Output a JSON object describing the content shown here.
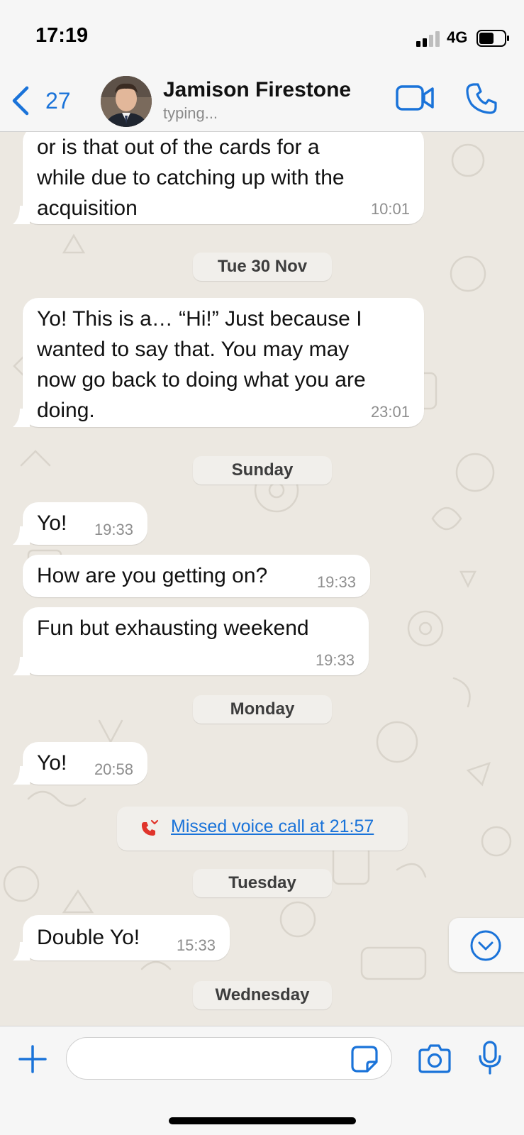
{
  "status_bar": {
    "time": "17:19",
    "network": "4G"
  },
  "header": {
    "back_count": "27",
    "contact_name": "Jamison Firestone",
    "contact_status": "typing..."
  },
  "messages": [
    {
      "text": [
        "or is that out of the cards for a",
        "while due to catching up with the",
        "acquisition"
      ],
      "time": "10:01"
    },
    {
      "text": [
        "Yo!  This is a… “Hi!” Just because I",
        "wanted to say that. You may may",
        "now go back to doing what you are",
        "doing."
      ],
      "time": "23:01"
    },
    {
      "text": [
        "Yo!"
      ],
      "time": "19:33"
    },
    {
      "text": [
        "How are you getting on?"
      ],
      "time": "19:33"
    },
    {
      "text": [
        "Fun but exhausting weekend"
      ],
      "time": "19:33"
    },
    {
      "text": [
        "Yo!"
      ],
      "time": "20:58"
    },
    {
      "text": [
        "Double Yo!"
      ],
      "time": "15:33"
    }
  ],
  "date_separators": [
    "Tue 30 Nov",
    "Sunday",
    "Monday",
    "Tuesday",
    "Wednesday"
  ],
  "missed_call": {
    "text": "Missed voice call at 21:57"
  },
  "input": {
    "placeholder": ""
  },
  "colors": {
    "accent": "#1a73d9",
    "missed_call_red": "#e0342b",
    "wallpaper": "#ece8e1"
  }
}
